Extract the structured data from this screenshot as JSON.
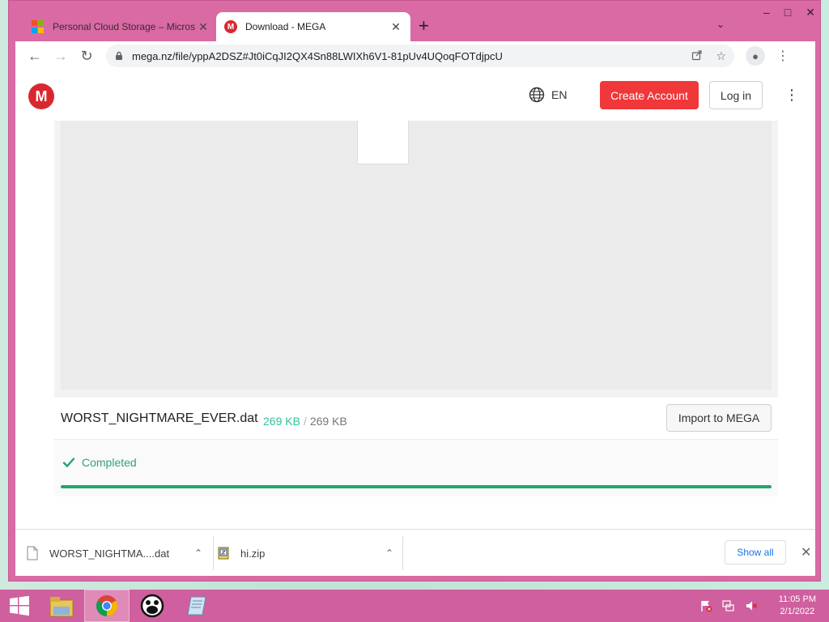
{
  "browser": {
    "tabs": [
      {
        "title": "Personal Cloud Storage – Micros",
        "active": false
      },
      {
        "title": "Download - MEGA",
        "active": true
      }
    ],
    "url": "mega.nz/file/yppA2DSZ#Jt0iCqJI2QX4Sn88LWIXh6V1-81pUv4UQoqFOTdjpcU"
  },
  "header": {
    "language": "EN",
    "create_account": "Create Account",
    "login": "Log in"
  },
  "file": {
    "name": "WORST_NIGHTMARE_EVER.dat",
    "downloaded": "269 KB",
    "separator": "/",
    "total": "269 KB",
    "import_label": "Import to MEGA"
  },
  "status": {
    "text": "Completed",
    "progress": 1.0
  },
  "downloads": {
    "items": [
      {
        "name": "WORST_NIGHTMA....dat"
      },
      {
        "name": "hi.zip"
      }
    ],
    "show_all": "Show all"
  },
  "taskbar": {
    "time": "11:05 PM",
    "date": "2/1/2022"
  },
  "colors": {
    "mega_red": "#d9272e",
    "create_button": "#f0373a",
    "progress": "#23a56f",
    "window_frame": "#d96aa4"
  }
}
